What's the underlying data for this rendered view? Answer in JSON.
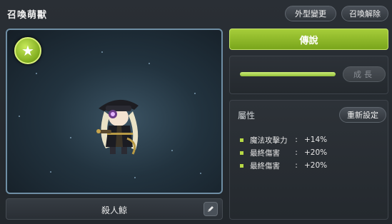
{
  "window": {
    "title": "召喚萌獸",
    "buttons": {
      "appearance_label": "外型變更",
      "release_label": "召喚解除"
    }
  },
  "pet": {
    "name": "殺人鯨",
    "grade": "傳說",
    "grade_color": "#8fba2a",
    "grade_icon": "star-icon"
  },
  "growth": {
    "progress_fraction": 1.0,
    "button_label": "成長"
  },
  "attributes": {
    "title": "屬性",
    "reset_label": "重新設定",
    "items": [
      {
        "name": "魔法攻擊力",
        "sep": ":",
        "value": "+14%"
      },
      {
        "name": "最終傷害",
        "sep": ":",
        "value": "+20%"
      },
      {
        "name": "最終傷害",
        "sep": ":",
        "value": "+20%"
      }
    ]
  }
}
